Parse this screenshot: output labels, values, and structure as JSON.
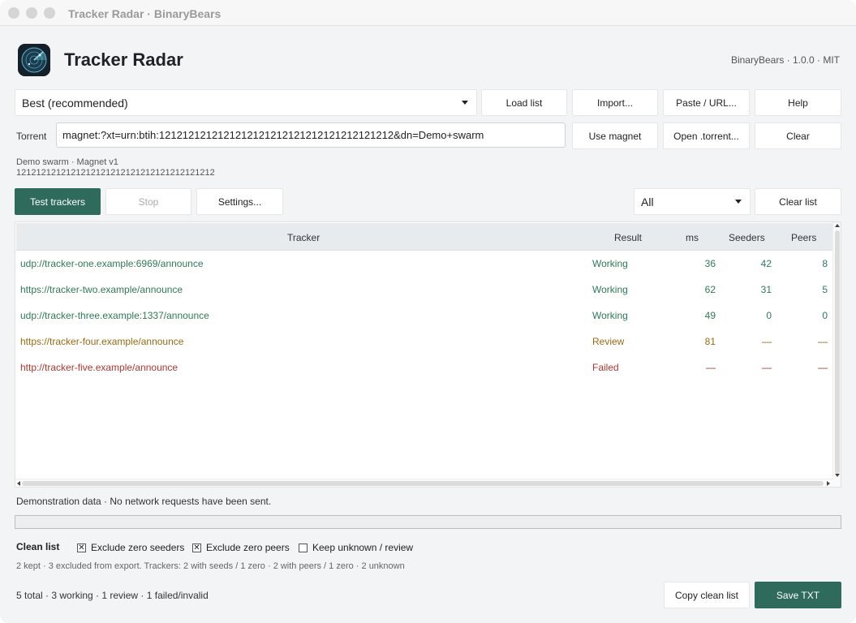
{
  "window": {
    "title": "Tracker Radar · BinaryBears"
  },
  "header": {
    "app_title": "Tracker Radar",
    "version": "BinaryBears · 1.0.0 · MIT"
  },
  "toolbar": {
    "list_select": "Best (recommended)",
    "load_list": "Load list",
    "import": "Import...",
    "paste_url": "Paste / URL...",
    "help": "Help"
  },
  "torrent": {
    "label": "Torrent",
    "value": "magnet:?xt=urn:btih:1212121212121212121212121212121212121212&dn=Demo+swarm",
    "use_magnet": "Use magnet",
    "open_torrent": "Open .torrent...",
    "clear": "Clear",
    "meta_line1": "Demo swarm · Magnet v1",
    "meta_line2": "1212121212121212121212121212121212121212"
  },
  "actions": {
    "test": "Test trackers",
    "stop": "Stop",
    "settings": "Settings...",
    "filter": "All",
    "clear_list": "Clear list"
  },
  "table": {
    "headers": {
      "tracker": "Tracker",
      "result": "Result",
      "ms": "ms",
      "seeders": "Seeders",
      "peers": "Peers"
    },
    "rows": [
      {
        "tracker": "udp://tracker-one.example:6969/announce",
        "result": "Working",
        "ms": "36",
        "seeders": "42",
        "peers": "8",
        "color": "#2e7a5a"
      },
      {
        "tracker": "https://tracker-two.example/announce",
        "result": "Working",
        "ms": "62",
        "seeders": "31",
        "peers": "5",
        "color": "#2e7a5a"
      },
      {
        "tracker": "udp://tracker-three.example:1337/announce",
        "result": "Working",
        "ms": "49",
        "seeders": "0",
        "peers": "0",
        "color": "#2e7a5a"
      },
      {
        "tracker": "https://tracker-four.example/announce",
        "result": "Review",
        "ms": "81",
        "seeders": "—",
        "peers": "—",
        "color": "#9a6a12"
      },
      {
        "tracker": "http://tracker-five.example/announce",
        "result": "Failed",
        "ms": "—",
        "seeders": "—",
        "peers": "—",
        "color": "#b3362f"
      }
    ]
  },
  "status": {
    "text": "Demonstration data · No network requests have been sent.",
    "progress": 0
  },
  "clean": {
    "label": "Clean list",
    "exclude_zero_seeders": {
      "label": "Exclude zero seeders",
      "checked": true
    },
    "exclude_zero_peers": {
      "label": "Exclude zero peers",
      "checked": true
    },
    "keep_unknown": {
      "label": "Keep unknown / review",
      "checked": false
    },
    "summary": "2 kept · 3 excluded from export. Trackers: 2 with seeds / 1 zero · 2 with peers / 1 zero · 2 unknown"
  },
  "footer": {
    "counts": "5 total · 3 working · 1 review · 1 failed/invalid",
    "copy_clean": "Copy clean list",
    "save_txt": "Save TXT"
  },
  "colors": {
    "accent": "#2f6b5c",
    "working": "#2e7a5a",
    "review": "#9a6a12",
    "failed": "#b3362f"
  }
}
